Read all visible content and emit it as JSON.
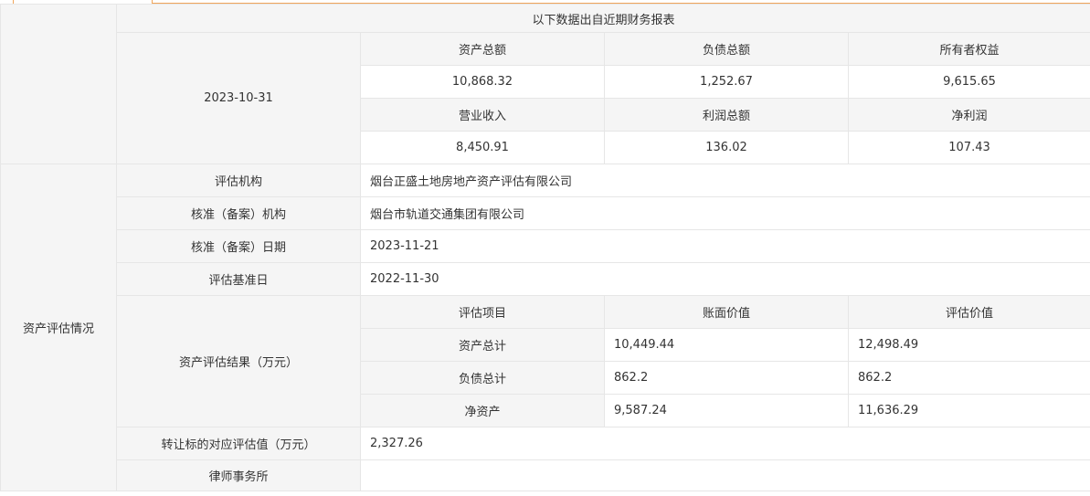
{
  "financial": {
    "title": "以下数据出自近期财务报表",
    "date": "2023-10-31",
    "headers1": [
      "资产总额",
      "负债总额",
      "所有者权益"
    ],
    "values1": [
      "10,868.32",
      "1,252.67",
      "9,615.65"
    ],
    "headers2": [
      "营业收入",
      "利润总额",
      "净利润"
    ],
    "values2": [
      "8,450.91",
      "136.02",
      "107.43"
    ]
  },
  "valuation": {
    "section_label": "资产评估情况",
    "rows": [
      {
        "label": "评估机构",
        "value": "烟台正盛土地房地产资产评估有限公司"
      },
      {
        "label": "核准（备案）机构",
        "value": "烟台市轨道交通集团有限公司"
      },
      {
        "label": "核准（备案）日期",
        "value": "2023-11-21"
      },
      {
        "label": "评估基准日",
        "value": "2022-11-30"
      }
    ],
    "result": {
      "label": "资产评估结果（万元）",
      "headers": [
        "评估项目",
        "账面价值",
        "评估价值"
      ],
      "items": [
        {
          "name": "资产总计",
          "book": "10,449.44",
          "appraised": "12,498.49"
        },
        {
          "name": "负债总计",
          "book": "862.2",
          "appraised": "862.2"
        },
        {
          "name": "净资产",
          "book": "9,587.24",
          "appraised": "11,636.29"
        }
      ]
    },
    "transfer": {
      "label": "转让标的对应评估值（万元）",
      "value": "2,327.26"
    },
    "law_firm": {
      "label": "律师事务所",
      "value": ""
    }
  }
}
